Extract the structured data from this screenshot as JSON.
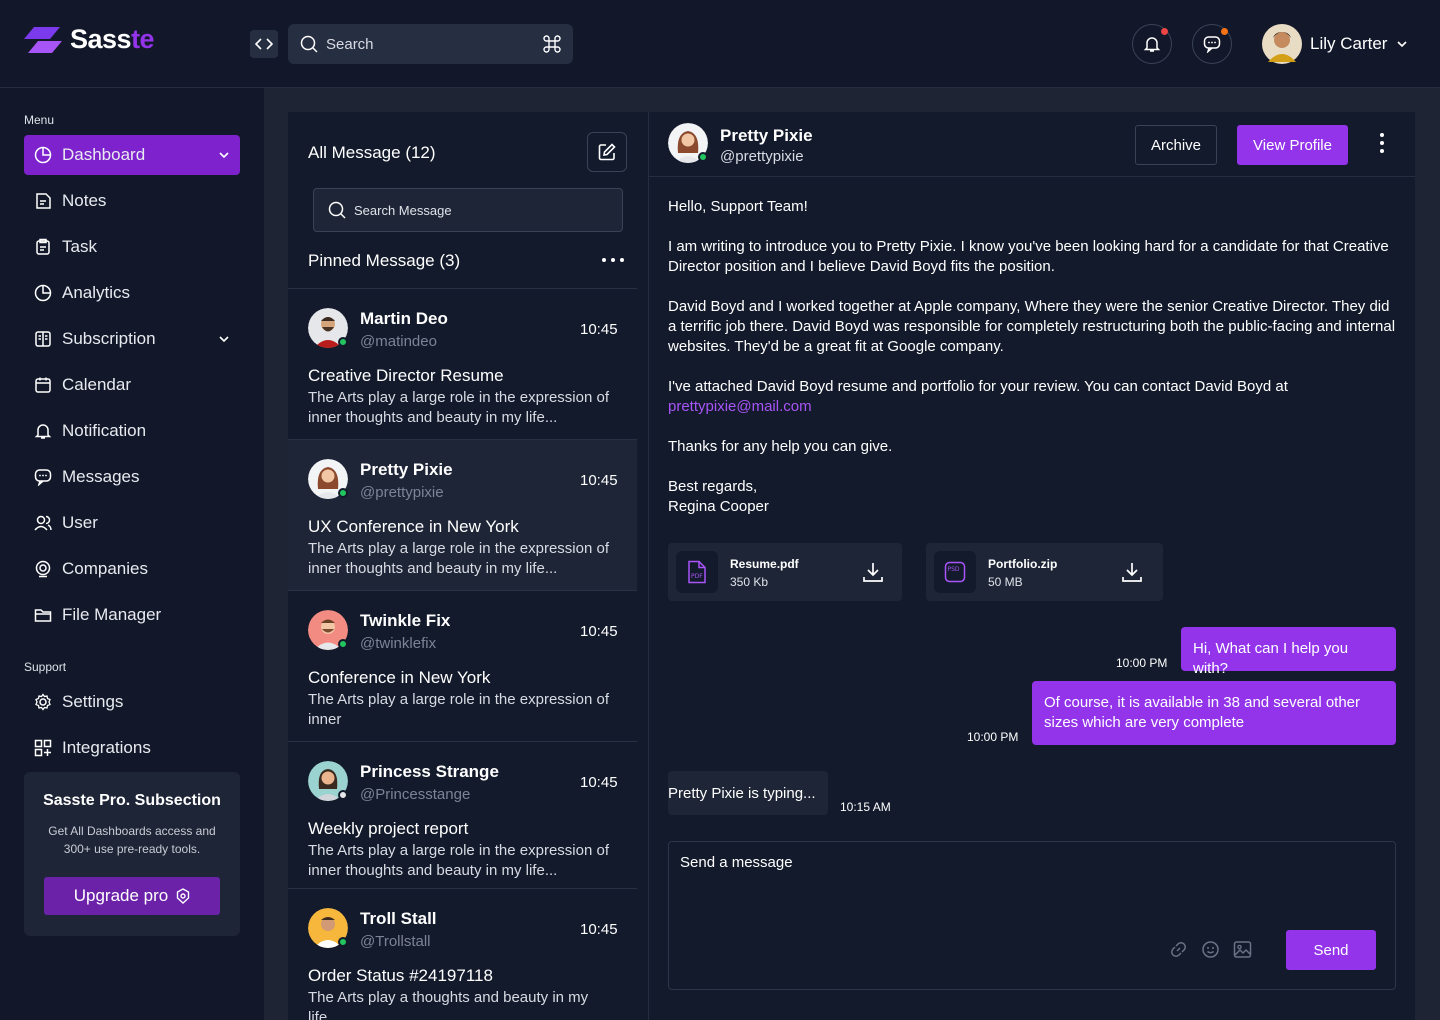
{
  "app": {
    "brand_prefix": "Sass",
    "brand_suffix": "te"
  },
  "header": {
    "search_placeholder": "Search",
    "user_name": "Lily Carter"
  },
  "sidebar": {
    "menu_label": "Menu",
    "items": [
      {
        "label": "Dashboard",
        "icon": "pie-chart-icon",
        "active": true
      },
      {
        "label": "Notes",
        "icon": "note-icon"
      },
      {
        "label": "Task",
        "icon": "task-icon"
      },
      {
        "label": "Analytics",
        "icon": "analytics-icon"
      },
      {
        "label": "Subscription",
        "icon": "subscription-icon"
      },
      {
        "label": "Calendar",
        "icon": "calendar-icon"
      },
      {
        "label": "Notification",
        "icon": "bell-icon"
      },
      {
        "label": "Messages",
        "icon": "chat-icon"
      },
      {
        "label": "User",
        "icon": "users-icon"
      },
      {
        "label": "Companies",
        "icon": "location-icon"
      },
      {
        "label": "File Manager",
        "icon": "folder-icon"
      }
    ],
    "support_label": "Support",
    "support_items": [
      {
        "label": "Settings",
        "icon": "gear-icon"
      },
      {
        "label": "Integrations",
        "icon": "grid-plus-icon"
      }
    ],
    "promo": {
      "title": "Sasste Pro. Subsection",
      "description": "Get All Dashboards access and 300+ use pre-ready tools.",
      "button": "Upgrade pro"
    }
  },
  "inbox": {
    "title": "All Message (12)",
    "search_placeholder": "Search Message",
    "pinned_title": "Pinned Message (3)",
    "conversations": [
      {
        "name": "Martin Deo",
        "handle": "@matindeo",
        "time": "10:45",
        "subject": "Creative Director Resume",
        "preview": "The Arts play a large role in the expression of inner thoughts and beauty in my life...",
        "online": true
      },
      {
        "name": "Pretty Pixie",
        "handle": "@prettypixie",
        "time": "10:45",
        "subject": "UX Conference in New York",
        "preview": "The Arts play a large role in the expression of inner thoughts and beauty in my life...",
        "online": true,
        "selected": true
      },
      {
        "name": "Twinkle Fix",
        "handle": "@twinklefix",
        "time": "10:45",
        "subject": "Conference in New York",
        "preview": "The Arts play a large role in the expression of inner",
        "online": true
      },
      {
        "name": "Princess Strange",
        "handle": "@Princesstange",
        "time": "10:45",
        "subject": "Weekly project report",
        "preview": "The Arts play a large role in the expression of inner thoughts and beauty in my life...",
        "online": false
      },
      {
        "name": "Troll Stall",
        "handle": "@Trollstall",
        "time": "10:45",
        "subject": "Order Status #24197118",
        "preview": "The Arts play a thoughts and beauty in my life...",
        "online": true
      }
    ]
  },
  "chat": {
    "name": "Pretty Pixie",
    "handle": "@prettypixie",
    "archive_label": "Archive",
    "profile_label": "View Profile",
    "letter": {
      "greeting": "Hello, Support Team!",
      "p1": "I am writing to introduce you to  Pretty Pixie. I know you've been looking hard for a candidate for that Creative Director position and I believe David Boyd fits the position.",
      "p2": "David Boyd and I worked together at Apple company, Where they were the senior Creative Director. They did a terrific job there. David Boyd was responsible for completely restructuring both the public-facing and internal websites. They'd be a great fit at Google company.",
      "p3": "I've attached David Boyd resume and portfolio for your review. You can contact David Boyd at",
      "email": "prettypixie@mail.com",
      "p4": "Thanks for any help you can give.",
      "closing": "Best regards,",
      "signature": "Regina Cooper"
    },
    "attachments": [
      {
        "name": "Resume.pdf",
        "size": "350 Kb",
        "icon": "pdf-file-icon"
      },
      {
        "name": "Portfolio.zip",
        "size": "50 MB",
        "icon": "psd-file-icon"
      }
    ],
    "messages": [
      {
        "text": "Hi, What can I help you with?",
        "time": "10:00 PM"
      },
      {
        "text": "Of course, it is available in 38 and several other sizes which are very complete",
        "time": "10:00 PM"
      }
    ],
    "typing_name": "Pretty Pixie",
    "typing_text": " is typing...",
    "typing_time": "10:15 AM",
    "composer_placeholder": "Send a message",
    "send_label": "Send"
  },
  "colors": {
    "accent": "#9333ea",
    "accent_dark": "#7e22ce",
    "background": "#1e2434",
    "panel": "#131a2b",
    "online": "#22c55e"
  }
}
